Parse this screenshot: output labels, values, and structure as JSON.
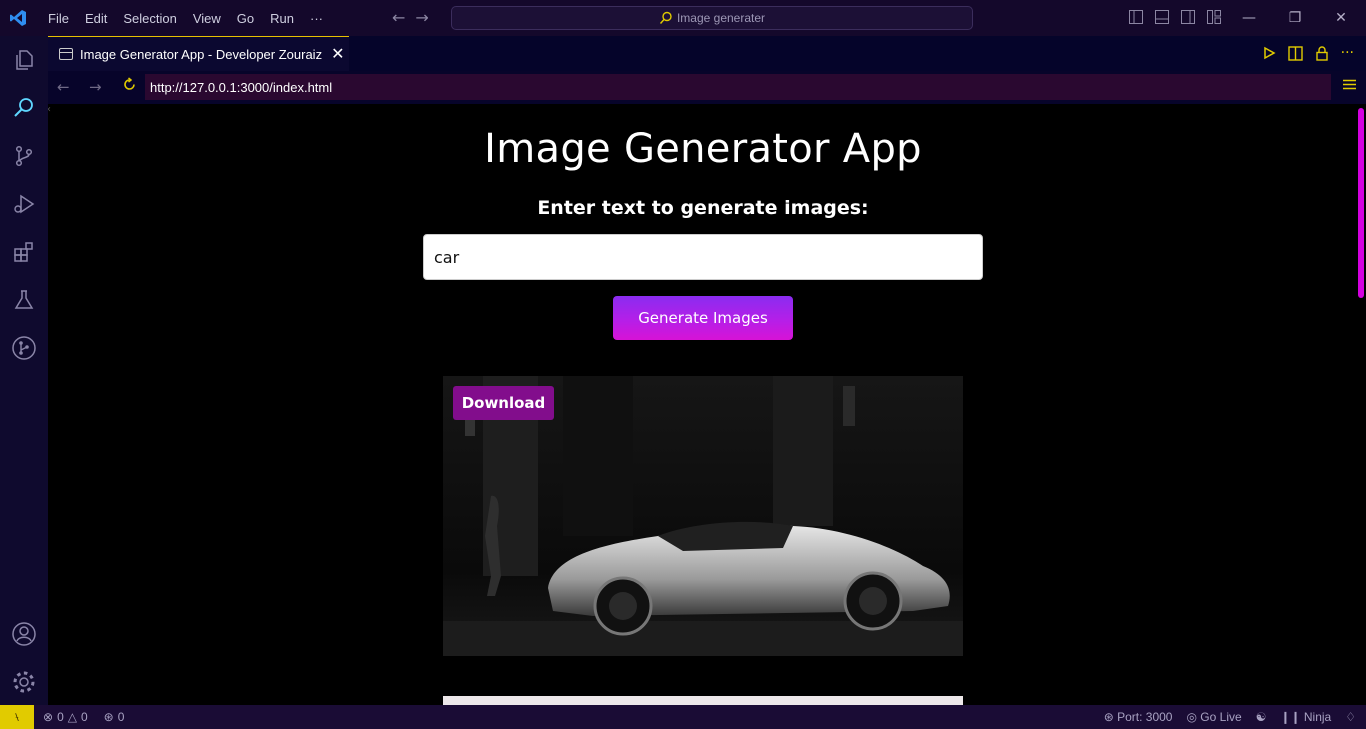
{
  "titlebar": {
    "menu": [
      "File",
      "Edit",
      "Selection",
      "View",
      "Go",
      "Run",
      "···"
    ],
    "search_text": "Image generater"
  },
  "tab": {
    "title": "Image Generator App - Developer Zouraiz",
    "close": "✕"
  },
  "browser": {
    "url": "http://127.0.0.1:3000/index.html"
  },
  "page": {
    "heading": "Image Generator App",
    "prompt_label": "Enter text to generate images:",
    "prompt_value": "car",
    "generate_label": "Generate Images",
    "download_label": "Download"
  },
  "statusbar": {
    "errors": "0",
    "warnings": "0",
    "ports": "0",
    "port_text": "Port: 3000",
    "go_live": "Go Live",
    "ninja": "Ninja"
  },
  "colors": {
    "accent_yellow": "#e1cb00",
    "scrollbar_magenta": "#d400e0",
    "download_purple": "#820d8c",
    "button_gradient_start": "#8a2cf0",
    "button_gradient_end": "#d713d6"
  }
}
